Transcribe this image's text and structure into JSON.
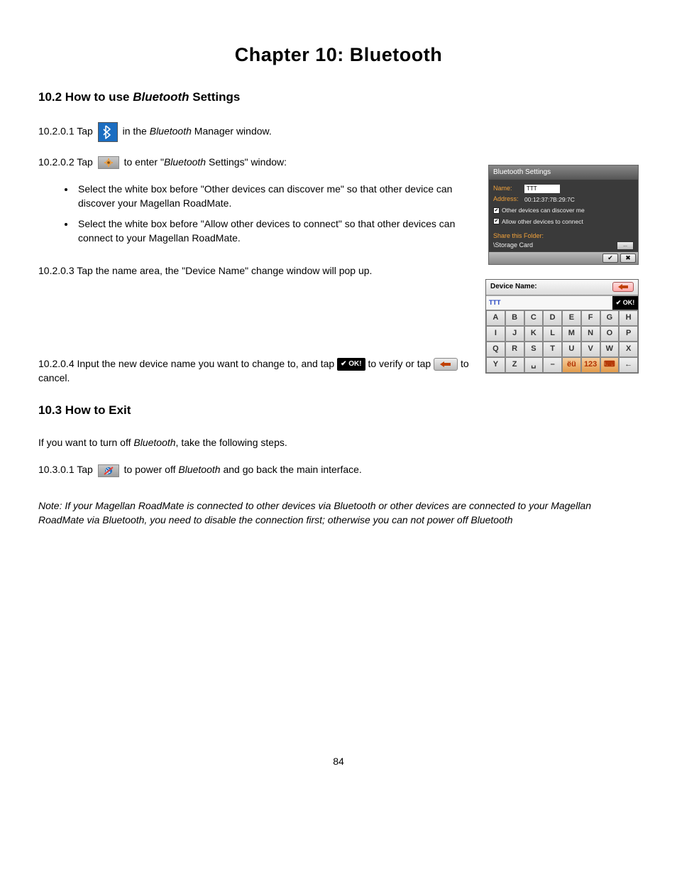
{
  "chapter_title": "Chapter 10: Bluetooth",
  "section_10_2": {
    "title_pre": "10.2 How to use ",
    "title_em": "Bluetooth",
    "title_post": " Settings",
    "step1_pre": "10.2.0.1 Tap ",
    "step1_post": " in the ",
    "step1_em": "Bluetooth",
    "step1_post2": " Manager window.",
    "step2_pre": "10.2.0.2 Tap ",
    "step2_post_a": " to enter \"",
    "step2_em": "Bluetooth",
    "step2_post_b": " Settings\" window:",
    "bullets": [
      "Select the white box before \"Other devices can discover me\" so that other device can discover your Magellan RoadMate.",
      "Select the white box before \"Allow other devices to connect\" so that other devices can connect to your Magellan RoadMate."
    ],
    "step3": "10.2.0.3 Tap the name area, the \"Device Name\" change window will pop up.",
    "step4_pre": "10.2.0.4 Input the new device name you want to change to, and tap ",
    "step4_mid": " to verify or tap ",
    "step4_post": " to cancel.",
    "ok_label": "OK!"
  },
  "section_10_3": {
    "title": "10.3 How to Exit",
    "intro_pre": "If you want to turn off ",
    "intro_em": "Bluetooth",
    "intro_post": ", take the following steps.",
    "step1_pre": "10.3.0.1 Tap ",
    "step1_mid": " to power off ",
    "step1_em": "Bluetooth",
    "step1_post": " and go back the main interface."
  },
  "note": "Note: If your Magellan RoadMate is connected to other devices via Bluetooth or other devices are connected to your Magellan RoadMate via Bluetooth, you need to disable the connection first; otherwise you can not power off Bluetooth",
  "page_number": "84",
  "bt_settings": {
    "header": "Bluetooth Settings",
    "name_label": "Name:",
    "name_value": "TTT",
    "addr_label": "Address:",
    "addr_value": "00:12:37:7B:29:7C",
    "check1": "Other devices can discover me",
    "check2": "Allow other devices to connect",
    "share_label": "Share this Folder:",
    "folder": "\\Storage Card",
    "browse": "..."
  },
  "keyboard": {
    "title": "Device Name:",
    "input_value": "TTT",
    "ok": "✔ OK!",
    "keys_rows": [
      [
        "A",
        "B",
        "C",
        "D",
        "E",
        "F",
        "G",
        "H"
      ],
      [
        "I",
        "J",
        "K",
        "L",
        "M",
        "N",
        "O",
        "P"
      ],
      [
        "Q",
        "R",
        "S",
        "T",
        "U",
        "V",
        "W",
        "X"
      ],
      [
        "Y",
        "Z",
        "␣",
        "–",
        "ëü",
        "123",
        "⌨",
        "←"
      ]
    ]
  }
}
